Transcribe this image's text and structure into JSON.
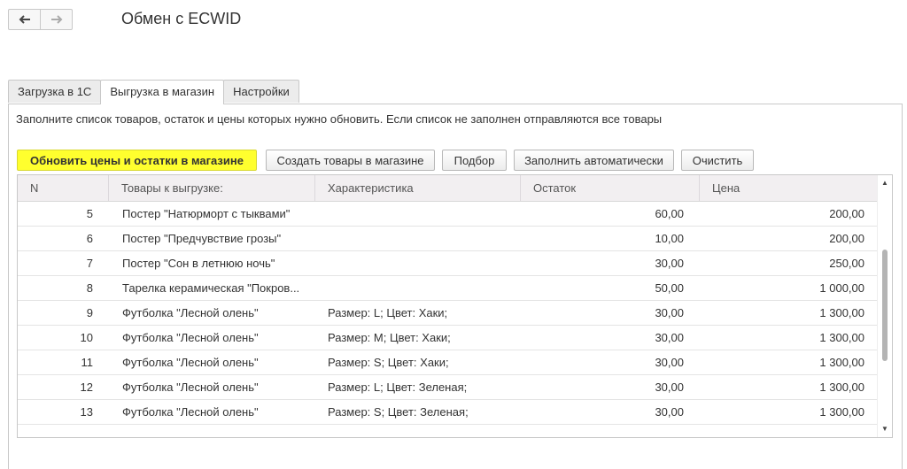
{
  "window": {
    "title": "Обмен с ECWID"
  },
  "nav": {
    "back_icon": "arrow-left-icon",
    "forward_icon": "arrow-right-icon"
  },
  "tabs": [
    {
      "label": "Загрузка в 1С",
      "active": false
    },
    {
      "label": "Выгрузка в магазин",
      "active": true
    },
    {
      "label": "Настройки",
      "active": false
    }
  ],
  "hint": "Заполните список товаров, остаток и цены которых нужно обновить. Если список не заполнен отправляются все товары",
  "toolbar": {
    "update_label": "Обновить цены и остатки в магазине",
    "create_label": "Создать товары в магазине",
    "select_label": "Подбор",
    "autofill_label": "Заполнить автоматически",
    "clear_label": "Очистить"
  },
  "table": {
    "columns": [
      "N",
      "Товары к выгрузке:",
      "Характеристика",
      "Остаток",
      "Цена"
    ],
    "rows": [
      {
        "n": "5",
        "name": "Постер \"Натюрморт с тыквами\"",
        "char": "",
        "stock": "60,00",
        "price": "200,00"
      },
      {
        "n": "6",
        "name": "Постер \"Предчувствие грозы\"",
        "char": "",
        "stock": "10,00",
        "price": "200,00"
      },
      {
        "n": "7",
        "name": "Постер \"Сон в летнюю ночь\"",
        "char": "",
        "stock": "30,00",
        "price": "250,00"
      },
      {
        "n": "8",
        "name": "Тарелка керамическая \"Покров...",
        "char": "",
        "stock": "50,00",
        "price": "1 000,00"
      },
      {
        "n": "9",
        "name": "Футболка \"Лесной олень\"",
        "char": "Размер: L; Цвет: Хаки;",
        "stock": "30,00",
        "price": "1 300,00"
      },
      {
        "n": "10",
        "name": "Футболка \"Лесной олень\"",
        "char": "Размер: M; Цвет: Хаки;",
        "stock": "30,00",
        "price": "1 300,00"
      },
      {
        "n": "11",
        "name": "Футболка \"Лесной олень\"",
        "char": "Размер: S; Цвет: Хаки;",
        "stock": "30,00",
        "price": "1 300,00"
      },
      {
        "n": "12",
        "name": "Футболка \"Лесной олень\"",
        "char": "Размер: L; Цвет: Зеленая;",
        "stock": "30,00",
        "price": "1 300,00"
      },
      {
        "n": "13",
        "name": "Футболка \"Лесной олень\"",
        "char": "Размер: S; Цвет: Зеленая;",
        "stock": "30,00",
        "price": "1 300,00"
      }
    ]
  },
  "colors": {
    "primary_button": "#ffff2e",
    "header_bg": "#f2eff1",
    "border": "#c8c8c8"
  }
}
